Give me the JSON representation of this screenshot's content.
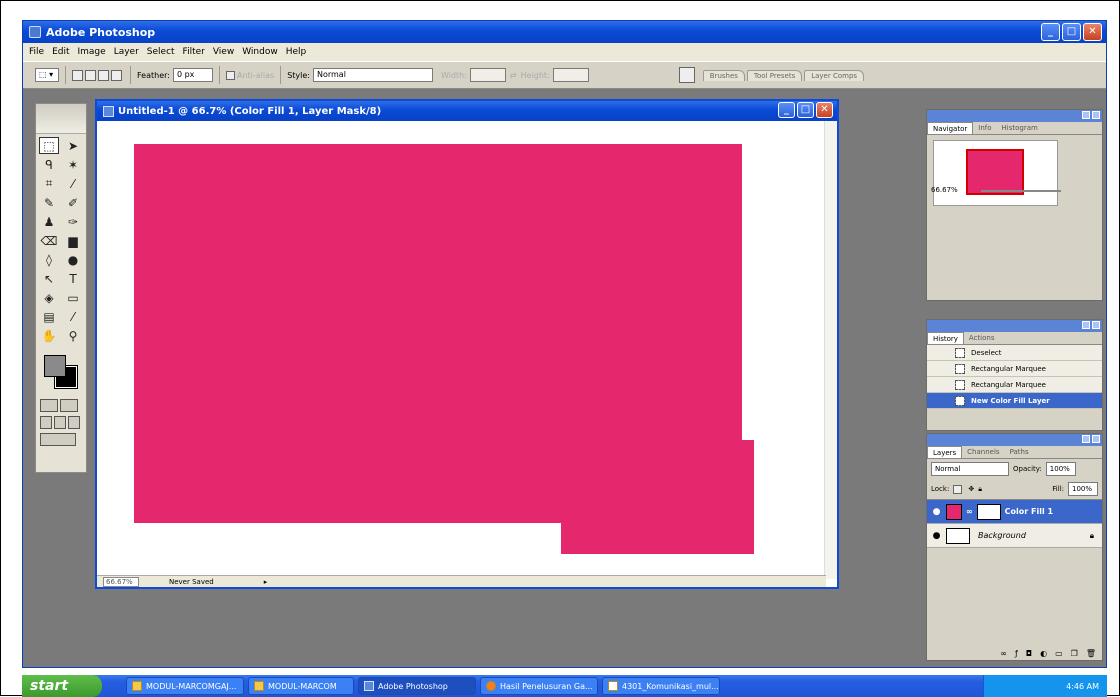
{
  "window": {
    "title": "Adobe Photoshop",
    "menu": [
      "File",
      "Edit",
      "Image",
      "Layer",
      "Select",
      "Filter",
      "View",
      "Window",
      "Help"
    ]
  },
  "options_bar": {
    "feather_label": "Feather:",
    "feather_value": "0 px",
    "antialias_label": "Anti-alias",
    "style_label": "Style:",
    "style_value": "Normal",
    "width_label": "Width:",
    "height_label": "Height:",
    "well_tabs": [
      "Brushes",
      "Tool Presets",
      "Layer Comps"
    ]
  },
  "document": {
    "title": "Untitled-1 @ 66.7% (Color Fill 1, Layer Mask/8)",
    "zoom": "66.67%",
    "status": "Never Saved",
    "fill_color": "#e5286e"
  },
  "navigator": {
    "tabs": [
      "Navigator",
      "Info",
      "Histogram"
    ],
    "zoom": "66.67%"
  },
  "history": {
    "tabs": [
      "History",
      "Actions"
    ],
    "items": [
      "Deselect",
      "Rectangular Marquee",
      "Rectangular Marquee",
      "New Color Fill Layer"
    ]
  },
  "layers": {
    "tabs": [
      "Layers",
      "Channels",
      "Paths"
    ],
    "blend_mode": "Normal",
    "opacity_label": "Opacity:",
    "opacity": "100%",
    "lock_label": "Lock:",
    "fill_label": "Fill:",
    "fill": "100%",
    "items": [
      {
        "name": "Color Fill 1",
        "selected": true
      },
      {
        "name": "Background",
        "selected": false
      }
    ]
  },
  "taskbar": {
    "start_label": "start",
    "tasks": [
      "MODUL-MARCOMGAJ...",
      "MODUL-MARCOM",
      "Adobe Photoshop",
      "Hasil Penelusuran Ga...",
      "4301_Komunikasi_mul..."
    ],
    "clock": "4:46 AM"
  }
}
